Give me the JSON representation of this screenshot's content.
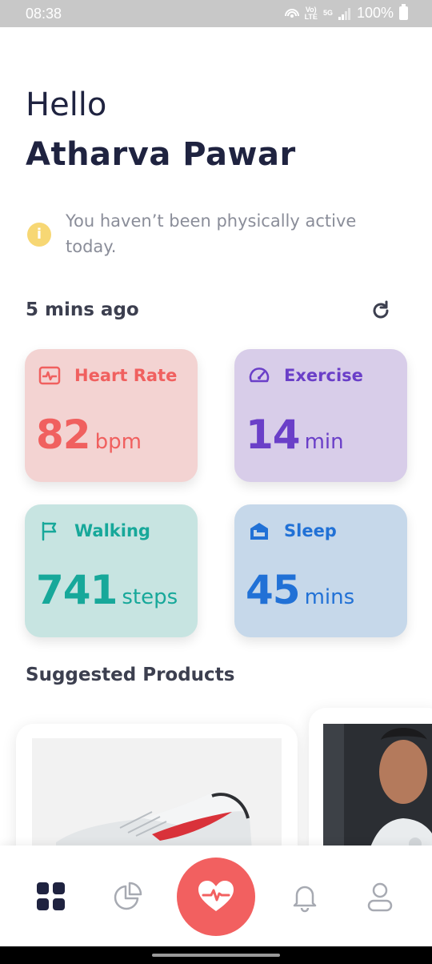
{
  "status_bar": {
    "time": "08:38",
    "network_label": "5G",
    "volte_label": "VoLTE",
    "battery": "100%"
  },
  "greeting": {
    "hello": "Hello",
    "name": "Atharva Pawar"
  },
  "notice": {
    "text": "You haven’t been physically active today.",
    "icon": "info-icon",
    "icon_glyph": "i"
  },
  "updated": {
    "text": "5 mins ago",
    "icon": "refresh-icon"
  },
  "cards": {
    "heart_rate": {
      "label": "Heart Rate",
      "value": "82",
      "unit": "bpm",
      "icon": "heart-rate-icon",
      "color": "#f0605f",
      "bg": "#f3d3d2"
    },
    "exercise": {
      "label": "Exercise",
      "value": "14",
      "unit": "min",
      "icon": "speedometer-icon",
      "color": "#6a3fc8",
      "bg": "#d8cde9"
    },
    "walking": {
      "label": "Walking",
      "value": "741",
      "unit": "steps",
      "icon": "flag-icon",
      "color": "#17a89a",
      "bg": "#c7e4e1"
    },
    "sleep": {
      "label": "Sleep",
      "value": "45",
      "unit": "mins",
      "icon": "bed-icon",
      "color": "#2171d6",
      "bg": "#c6d8ea"
    }
  },
  "suggested": {
    "title": "Suggested Products",
    "items": [
      {
        "image": "sneaker-image"
      },
      {
        "image": "tshirt-model-image"
      }
    ]
  },
  "bottom_nav": {
    "items": [
      {
        "icon": "dashboard-icon",
        "active": true
      },
      {
        "icon": "pie-chart-icon",
        "active": false
      },
      {
        "icon": "heartbeat-icon",
        "active": false
      },
      {
        "icon": "bell-icon",
        "active": false
      },
      {
        "icon": "profile-icon",
        "active": false
      }
    ],
    "accent": "#f26060"
  }
}
